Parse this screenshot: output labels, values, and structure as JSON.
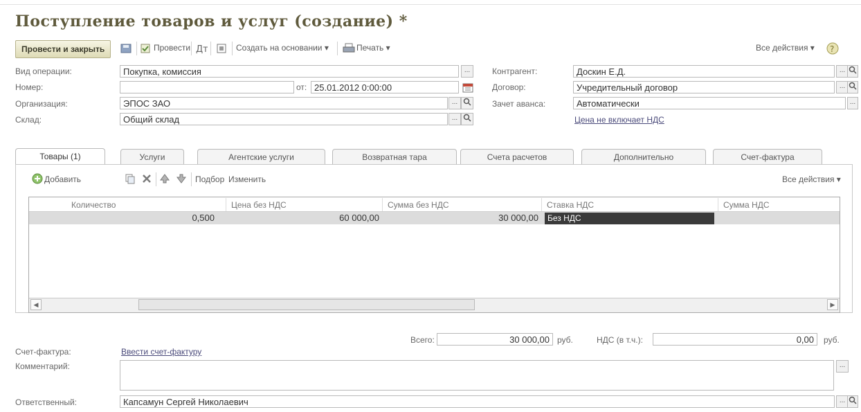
{
  "window": {
    "title": "Поступление товаров и услуг (создание) *"
  },
  "toolbar": {
    "post_close": "Провести и закрыть",
    "post": "Провести",
    "create_based": "Создать на основании ▾",
    "print": "Печать ▾",
    "all_actions": "Все действия ▾"
  },
  "form": {
    "operation_label": "Вид операции:",
    "operation_value": "Покупка, комиссия",
    "number_label": "Номер:",
    "number_value": "",
    "date_label": "от:",
    "date_value": "25.01.2012  0:00:00",
    "org_label": "Организация:",
    "org_value": "ЭПОС ЗАО",
    "warehouse_label": "Склад:",
    "warehouse_value": "Общий склад",
    "counterparty_label": "Контрагент:",
    "counterparty_value": "Доскин Е.Д.",
    "contract_label": "Договор:",
    "contract_value": "Учредительный договор",
    "advance_label": "Зачет аванса:",
    "advance_value": "Автоматически",
    "price_vat_link": "Цена не включает НДС"
  },
  "tabs": [
    {
      "label": "Товары (1)"
    },
    {
      "label": "Услуги"
    },
    {
      "label": "Агентские услуги"
    },
    {
      "label": "Возвратная тара"
    },
    {
      "label": "Счета расчетов"
    },
    {
      "label": "Дополнительно"
    },
    {
      "label": "Счет-фактура"
    }
  ],
  "table_toolbar": {
    "add": "Добавить",
    "pick": "Подбор",
    "change": "Изменить",
    "all_actions": "Все действия ▾"
  },
  "table": {
    "columns": [
      "Количество",
      "Цена без НДС",
      "Сумма без НДС",
      "Ставка НДС",
      "Сумма НДС"
    ],
    "rows": [
      {
        "qty": "0,500",
        "price": "60 000,00",
        "sum": "30 000,00",
        "vat_rate": "Без НДС",
        "vat_sum": ""
      }
    ]
  },
  "totals": {
    "total_label": "Всего:",
    "total_value": "30 000,00",
    "currency": "руб.",
    "vat_label": "НДС (в т.ч.):",
    "vat_value": "0,00",
    "vat_currency": "руб."
  },
  "footer": {
    "invoice_label": "Счет-фактура:",
    "invoice_link": "Ввести счет-фактуру",
    "comment_label": "Комментарий:",
    "comment_value": "",
    "responsible_label": "Ответственный:",
    "responsible_value": "Капсамун Сергей Николаевич"
  }
}
